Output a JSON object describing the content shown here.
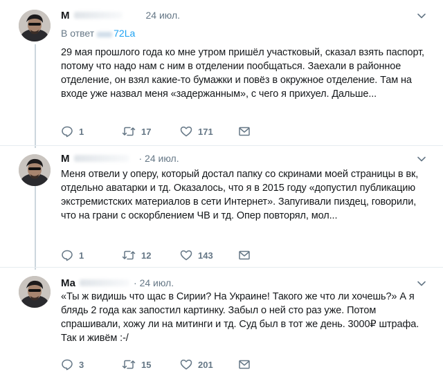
{
  "colors": {
    "text": "#14171a",
    "secondary": "#657786",
    "link": "#1da1f2",
    "thread_line": "#ccd6dd",
    "divider": "#e6ecf0"
  },
  "tweets": [
    {
      "name": "М",
      "date": "24 июл.",
      "reply_prefix": "В ответ",
      "reply_handle": "72La",
      "text": "29 мая прошлого года ко мне утром пришёл участковый, сказал взять паспорт, потому что надо нам с ним в отделении пообщаться. Заехали в районное отделение, он взял какие-то бумажки и повёз в окружное отделение. Там на входе уже назвал меня «задержанным», с чего я прихуел. Дальше...",
      "replies": "1",
      "retweets": "17",
      "likes": "171"
    },
    {
      "name": "М",
      "date": "· 24 июл.",
      "text": "Меня отвели у оперу, который достал папку со скринами моей страницы в вк, отдельно аватарки и тд. Оказалось, что я в 2015 году «допустил публикацию экстремистских материалов в сети Интернет». Запугивали пиздец, говорили, что на грани с оскорблением ЧВ и тд. Опер повторял, мол...",
      "replies": "1",
      "retweets": "12",
      "likes": "143"
    },
    {
      "name": "Ма",
      "date": "· 24 июл.",
      "text": "«Ты ж видишь что щас в Сирии? На Украине! Такого же что ли хочешь?» А я блядь 2 года как запостил картинку. Забыл о ней сто раз уже. Потом спрашивали, хожу ли на митинги и тд. Суд был в тот же день. 3000₽ штрафа. Так и живём :-/",
      "replies": "3",
      "retweets": "15",
      "likes": "201"
    }
  ],
  "icons": {
    "reply": "reply-icon",
    "retweet": "retweet-icon",
    "like": "heart-icon",
    "dm": "envelope-icon",
    "more": "chevron-down-icon"
  }
}
